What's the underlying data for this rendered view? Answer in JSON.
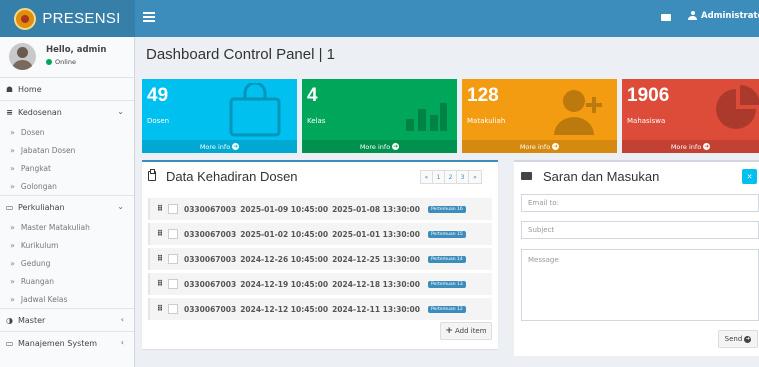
{
  "app": {
    "title": "PRESENSI"
  },
  "header": {
    "user_label": "Administrator"
  },
  "user_panel": {
    "greeting": "Hello, admin",
    "status": "Online"
  },
  "sidebar": {
    "home": "Home",
    "kedosenan": {
      "label": "Kedosenan",
      "items": [
        "Dosen",
        "Jabatan Dosen",
        "Pangkat",
        "Golongan"
      ]
    },
    "perkuliahan": {
      "label": "Perkuliahan",
      "items": [
        "Master Matakuliah",
        "Kurikulum",
        "Gedung",
        "Ruangan",
        "Jadwal Kelas"
      ]
    },
    "master": "Master",
    "manajemen": "Manajemen System"
  },
  "page": {
    "title": "Dashboard Control Panel | 1"
  },
  "stats": [
    {
      "value": "49",
      "label": "Dosen",
      "more": "More info",
      "color": "#00c0ef"
    },
    {
      "value": "4",
      "label": "Kelas",
      "more": "More info",
      "color": "#00a65a"
    },
    {
      "value": "128",
      "label": "Matakuliah",
      "more": "More info",
      "color": "#f39c12"
    },
    {
      "value": "1906",
      "label": "Mahasiswa",
      "more": "More info",
      "color": "#dd4b39"
    }
  ],
  "attendance": {
    "title": "Data Kehadiran Dosen",
    "pager": [
      "«",
      "1",
      "2",
      "3",
      "»"
    ],
    "rows": [
      {
        "nip": "0330067003",
        "start": "2025-01-09 10:45:00",
        "end": "2025-01-08 13:30:00",
        "badge": "Pertemuan 16"
      },
      {
        "nip": "0330067003",
        "start": "2025-01-02 10:45:00",
        "end": "2025-01-01 13:30:00",
        "badge": "Pertemuan 15"
      },
      {
        "nip": "0330067003",
        "start": "2024-12-26 10:45:00",
        "end": "2024-12-25 13:30:00",
        "badge": "Pertemuan 14"
      },
      {
        "nip": "0330067003",
        "start": "2024-12-19 10:45:00",
        "end": "2024-12-18 13:30:00",
        "badge": "Pertemuan 13"
      },
      {
        "nip": "0330067003",
        "start": "2024-12-12 10:45:00",
        "end": "2024-12-11 13:30:00",
        "badge": "Pertemuan 12"
      }
    ],
    "add_label": "Add item"
  },
  "saran": {
    "title": "Saran dan Masukan",
    "email_placeholder": "Email to:",
    "subject_placeholder": "Subject",
    "message_placeholder": "Message",
    "send_label": "Send"
  }
}
